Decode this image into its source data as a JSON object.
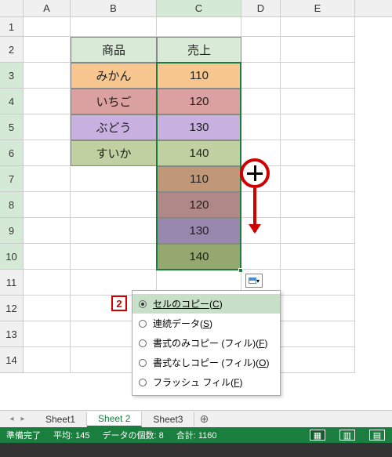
{
  "columns": [
    "A",
    "B",
    "C",
    "D",
    "E"
  ],
  "rows": [
    "1",
    "2",
    "3",
    "4",
    "5",
    "6",
    "7",
    "8",
    "9",
    "10",
    "11",
    "12",
    "13",
    "14"
  ],
  "header": {
    "b": "商品",
    "c": "売上"
  },
  "products": [
    "みかん",
    "いちご",
    "ぶどう",
    "すいか"
  ],
  "sales": [
    "110",
    "120",
    "130",
    "140",
    "110",
    "120",
    "130",
    "140"
  ],
  "menu": {
    "items": [
      {
        "label": "セルのコピー",
        "key": "C",
        "selected": true
      },
      {
        "label": "連続データ",
        "key": "S",
        "selected": false
      },
      {
        "label": "書式のみコピー (フィル)",
        "key": "F",
        "selected": false
      },
      {
        "label": "書式なしコピー (フィル)",
        "key": "O",
        "selected": false
      },
      {
        "label": "フラッシュ フィル",
        "key": "F",
        "selected": false
      }
    ]
  },
  "tabs": [
    "Sheet1",
    "Sheet 2",
    "Sheet3"
  ],
  "active_tab": 1,
  "status": {
    "ready": "準備完了",
    "avg_label": "平均:",
    "avg": "145",
    "count_label": "データの個数:",
    "count": "8",
    "sum_label": "合計:",
    "sum": "1160"
  },
  "callout": "2",
  "colors": {
    "accent": "#1a7e3e",
    "callout": "#d00000"
  }
}
